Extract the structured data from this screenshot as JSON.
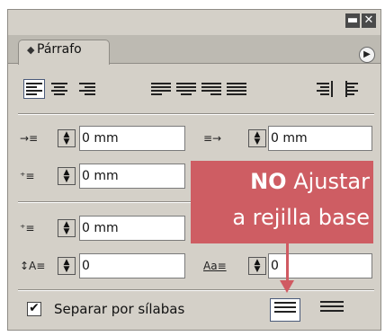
{
  "window": {
    "minimize_glyph": "▬",
    "close_glyph": "✕"
  },
  "panel": {
    "tab_label": "Párrafo",
    "tab_icon": "paragraph-panel-icon",
    "menu_icon": "flyout-menu-icon"
  },
  "alignment_buttons": [
    {
      "name": "align-left",
      "selected": true
    },
    {
      "name": "align-center",
      "selected": false
    },
    {
      "name": "align-right",
      "selected": false
    },
    {
      "name": "justify-left",
      "selected": false
    },
    {
      "name": "justify-center",
      "selected": false
    },
    {
      "name": "justify-right",
      "selected": false
    },
    {
      "name": "justify-all",
      "selected": false
    },
    {
      "name": "align-towards-spine",
      "selected": false
    },
    {
      "name": "align-away-from-spine",
      "selected": false
    }
  ],
  "fields": {
    "left_indent": "0 mm",
    "right_indent": "0 mm",
    "first_line_indent": "0 mm",
    "space_before": "0 mm",
    "space_after": "",
    "drop_cap_lines": "0",
    "drop_cap_chars": "0"
  },
  "annotation": {
    "bold": "NO",
    "rest": " Ajustar",
    "line2": "a rejilla base",
    "color": "#cd535a"
  },
  "hyphenate": {
    "label": "Separar por sílabas",
    "checked": true,
    "check_glyph": "✔"
  },
  "grid_align": {
    "do_not_align": "do-not-align-to-baseline-grid",
    "align": "align-to-baseline-grid",
    "selected": "do-not-align-to-baseline-grid"
  }
}
